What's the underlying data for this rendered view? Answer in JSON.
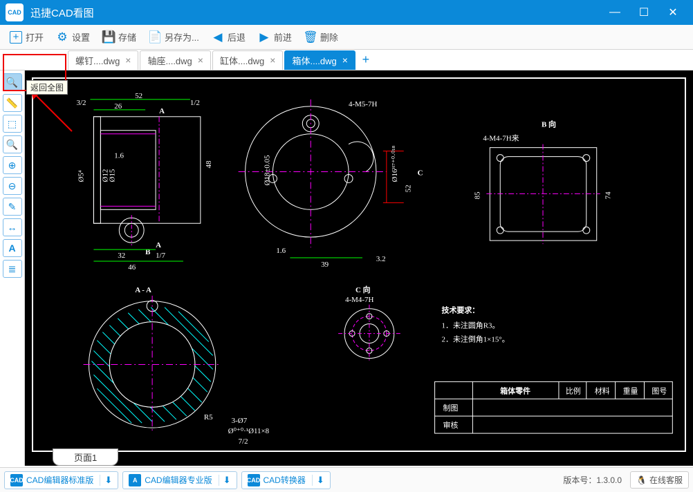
{
  "app": {
    "title": "迅捷CAD看图",
    "logo_text": "CAD"
  },
  "window_controls": {
    "minimize": "—",
    "maximize": "☐",
    "close": "✕"
  },
  "toolbar": {
    "open": "打开",
    "settings": "设置",
    "save": "存储",
    "saveas": "另存为...",
    "back": "后退",
    "forward": "前进",
    "delete": "删除"
  },
  "tabs": [
    {
      "label": "螺钉....dwg",
      "active": false
    },
    {
      "label": "轴座....dwg",
      "active": false
    },
    {
      "label": "缸体....dwg",
      "active": false
    },
    {
      "label": "箱体....dwg",
      "active": true
    }
  ],
  "tooltip": {
    "text": "返回全图"
  },
  "sidebar_tools": [
    "magnify",
    "ruler",
    "window-select",
    "zoom-window",
    "zoom-in",
    "zoom-out",
    "line",
    "dimension",
    "text",
    "layers"
  ],
  "page_tab": {
    "label": "页面1"
  },
  "status": {
    "links": [
      {
        "label": "CAD编辑器标准版",
        "icon": "CAD"
      },
      {
        "label": "CAD编辑器专业版",
        "icon": "A"
      },
      {
        "label": "CAD转换器",
        "icon": "CAD"
      }
    ],
    "version_label": "版本号：1.3.0.0",
    "customer_service": "在线客服"
  },
  "drawing": {
    "dim_top1": "52",
    "dim_32": "3/2",
    "dim_26": "26",
    "label_A": "A",
    "dim_A_tri": "1/2",
    "dim_O5a": "Ø5⁴",
    "dim_16": "1.6",
    "dim_48": "48",
    "dim_012": "Ø12",
    "dim_015": "Ø15",
    "dim_B": "B",
    "dim_B_tri": "1/7",
    "dim_bot32": "32",
    "dim_bot46": "46",
    "dim_phi18": "Ø18±0.05",
    "dim_4m": "4-M5-7H",
    "dim_bot16": "1.6",
    "dim_bot_39": "39",
    "dim_bot_32tri": "3.2",
    "dim_C": "C",
    "dim_52v": "52",
    "dim_phi16_red": "Ø16ᴴ⁷⁺⁰·⁰¹⁸",
    "label_Bdir": "B 向",
    "dim_4m47": "4-M4-7H来",
    "dim_85": "85",
    "dim_74": "74",
    "label_sec_AA": "A - A",
    "dim_R5": "R5",
    "dim_3phi7": "3-Ø7",
    "dim_phi11": "Ø⁰⁺⁰·¹Ø11×8",
    "dim_72": "7/2",
    "label_Cdir": "C 向",
    "dim_4m47c": "4-M4-7H",
    "req_title": "技术要求：",
    "req_1": "1．未注圆角R3。",
    "req_2": "2．未注倒角1×15°。",
    "tb_part": "箱体零件",
    "tb_hdrs": [
      "比例",
      "材料",
      "重量",
      "图号"
    ],
    "tb_rows": [
      "制图",
      "审核"
    ]
  }
}
